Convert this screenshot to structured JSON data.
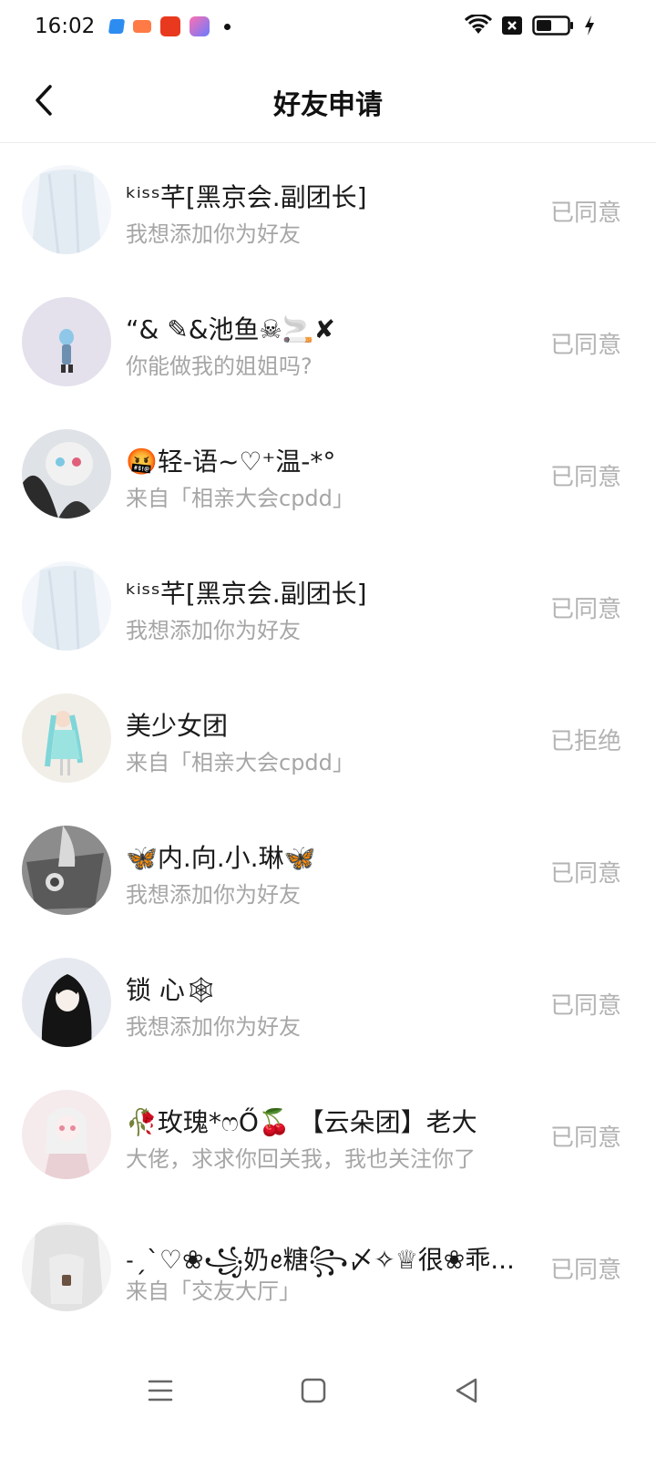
{
  "status_bar": {
    "time": "16:02",
    "icons": [
      "app-notification-icon",
      "game-notification-icon",
      "taobao-notification-icon",
      "shortcut-notification-icon",
      "more-dot-icon",
      "wifi-icon",
      "no-sim-icon",
      "battery-icon",
      "charging-icon"
    ]
  },
  "header": {
    "title": "好友申请",
    "back_icon": "chevron-left-icon"
  },
  "requests": [
    {
      "name": "ᵏⁱˢˢ芊[黑京会.副团长]",
      "message": "我想添加你为好友",
      "status": "已同意",
      "avatar_colors": [
        "#eef3f8",
        "#dfe7ef"
      ]
    },
    {
      "name": "“& ✎&池鱼☠🚬✘",
      "message": "你能做我的姐姐吗?",
      "status": "已同意",
      "avatar_colors": [
        "#e6e2ee",
        "#d8d3e6"
      ]
    },
    {
      "name": "🤬轻-语~♡⁺温-*°",
      "message": "来自「相亲大会cpdd」",
      "status": "已同意",
      "avatar_colors": [
        "#d9dde3",
        "#2b2b2b"
      ]
    },
    {
      "name": "ᵏⁱˢˢ芊[黑京会.副团长]",
      "message": "我想添加你为好友",
      "status": "已同意",
      "avatar_colors": [
        "#eef3f8",
        "#dfe7ef"
      ]
    },
    {
      "name": "美少女团",
      "message": "来自「相亲大会cpdd」",
      "status": "已拒绝",
      "avatar_colors": [
        "#f1eee8",
        "#7fd6d8"
      ]
    },
    {
      "name": "🦋内.向.小.琳🦋",
      "message": "我想添加你为好友",
      "status": "已同意",
      "avatar_colors": [
        "#9a9a9a",
        "#4a4a4a"
      ]
    },
    {
      "name": "锁  心🕸",
      "message": "我想添加你为好友",
      "status": "已同意",
      "avatar_colors": [
        "#e7e9f0",
        "#141414"
      ]
    },
    {
      "name": "🥀玫瑰*ෆŐ🍒 【云朵团】老大",
      "message": "大佬，求求你回关我，我也关注你了",
      "status": "已同意",
      "avatar_colors": [
        "#f3e6e8",
        "#e9d0d4"
      ]
    },
    {
      "name": "˗ˏˋ♡❀꧁奶ꫀ糖꧂〆✧♕很❀乖...",
      "message": "来自「交友大厅」",
      "status": "已同意",
      "avatar_colors": [
        "#f2f2f2",
        "#d6d6d6"
      ]
    }
  ],
  "nav_bar": {
    "menu_icon": "recent-apps-icon",
    "home_icon": "home-square-icon",
    "back_icon": "back-triangle-icon"
  }
}
